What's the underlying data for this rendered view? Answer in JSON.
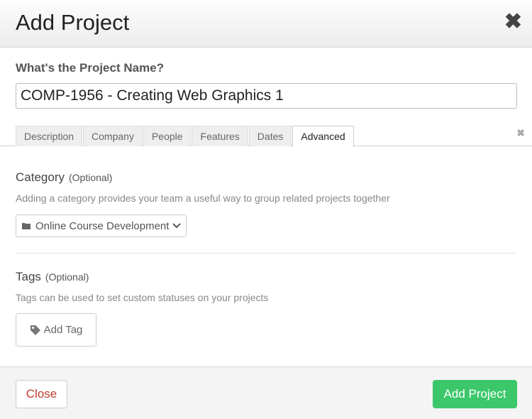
{
  "dialog": {
    "title": "Add Project",
    "close_icon": "close-icon"
  },
  "form": {
    "name_label": "What's the Project Name?",
    "name_value": "COMP-1956 - Creating Web Graphics 1"
  },
  "tabs": [
    {
      "label": "Description"
    },
    {
      "label": "Company"
    },
    {
      "label": "People"
    },
    {
      "label": "Features"
    },
    {
      "label": "Dates"
    },
    {
      "label": "Advanced",
      "active": true
    }
  ],
  "category": {
    "title": "Category",
    "optional": "(Optional)",
    "description": "Adding a category provides your team a useful way to group related projects together",
    "selected": "Online Course Development"
  },
  "tags": {
    "title": "Tags",
    "optional": "(Optional)",
    "description": "Tags can be used to set custom statuses on your projects",
    "add_label": "Add Tag"
  },
  "footer": {
    "close_label": "Close",
    "add_label": "Add Project"
  },
  "colors": {
    "primary": "#3cc86a",
    "danger": "#c0392b"
  }
}
